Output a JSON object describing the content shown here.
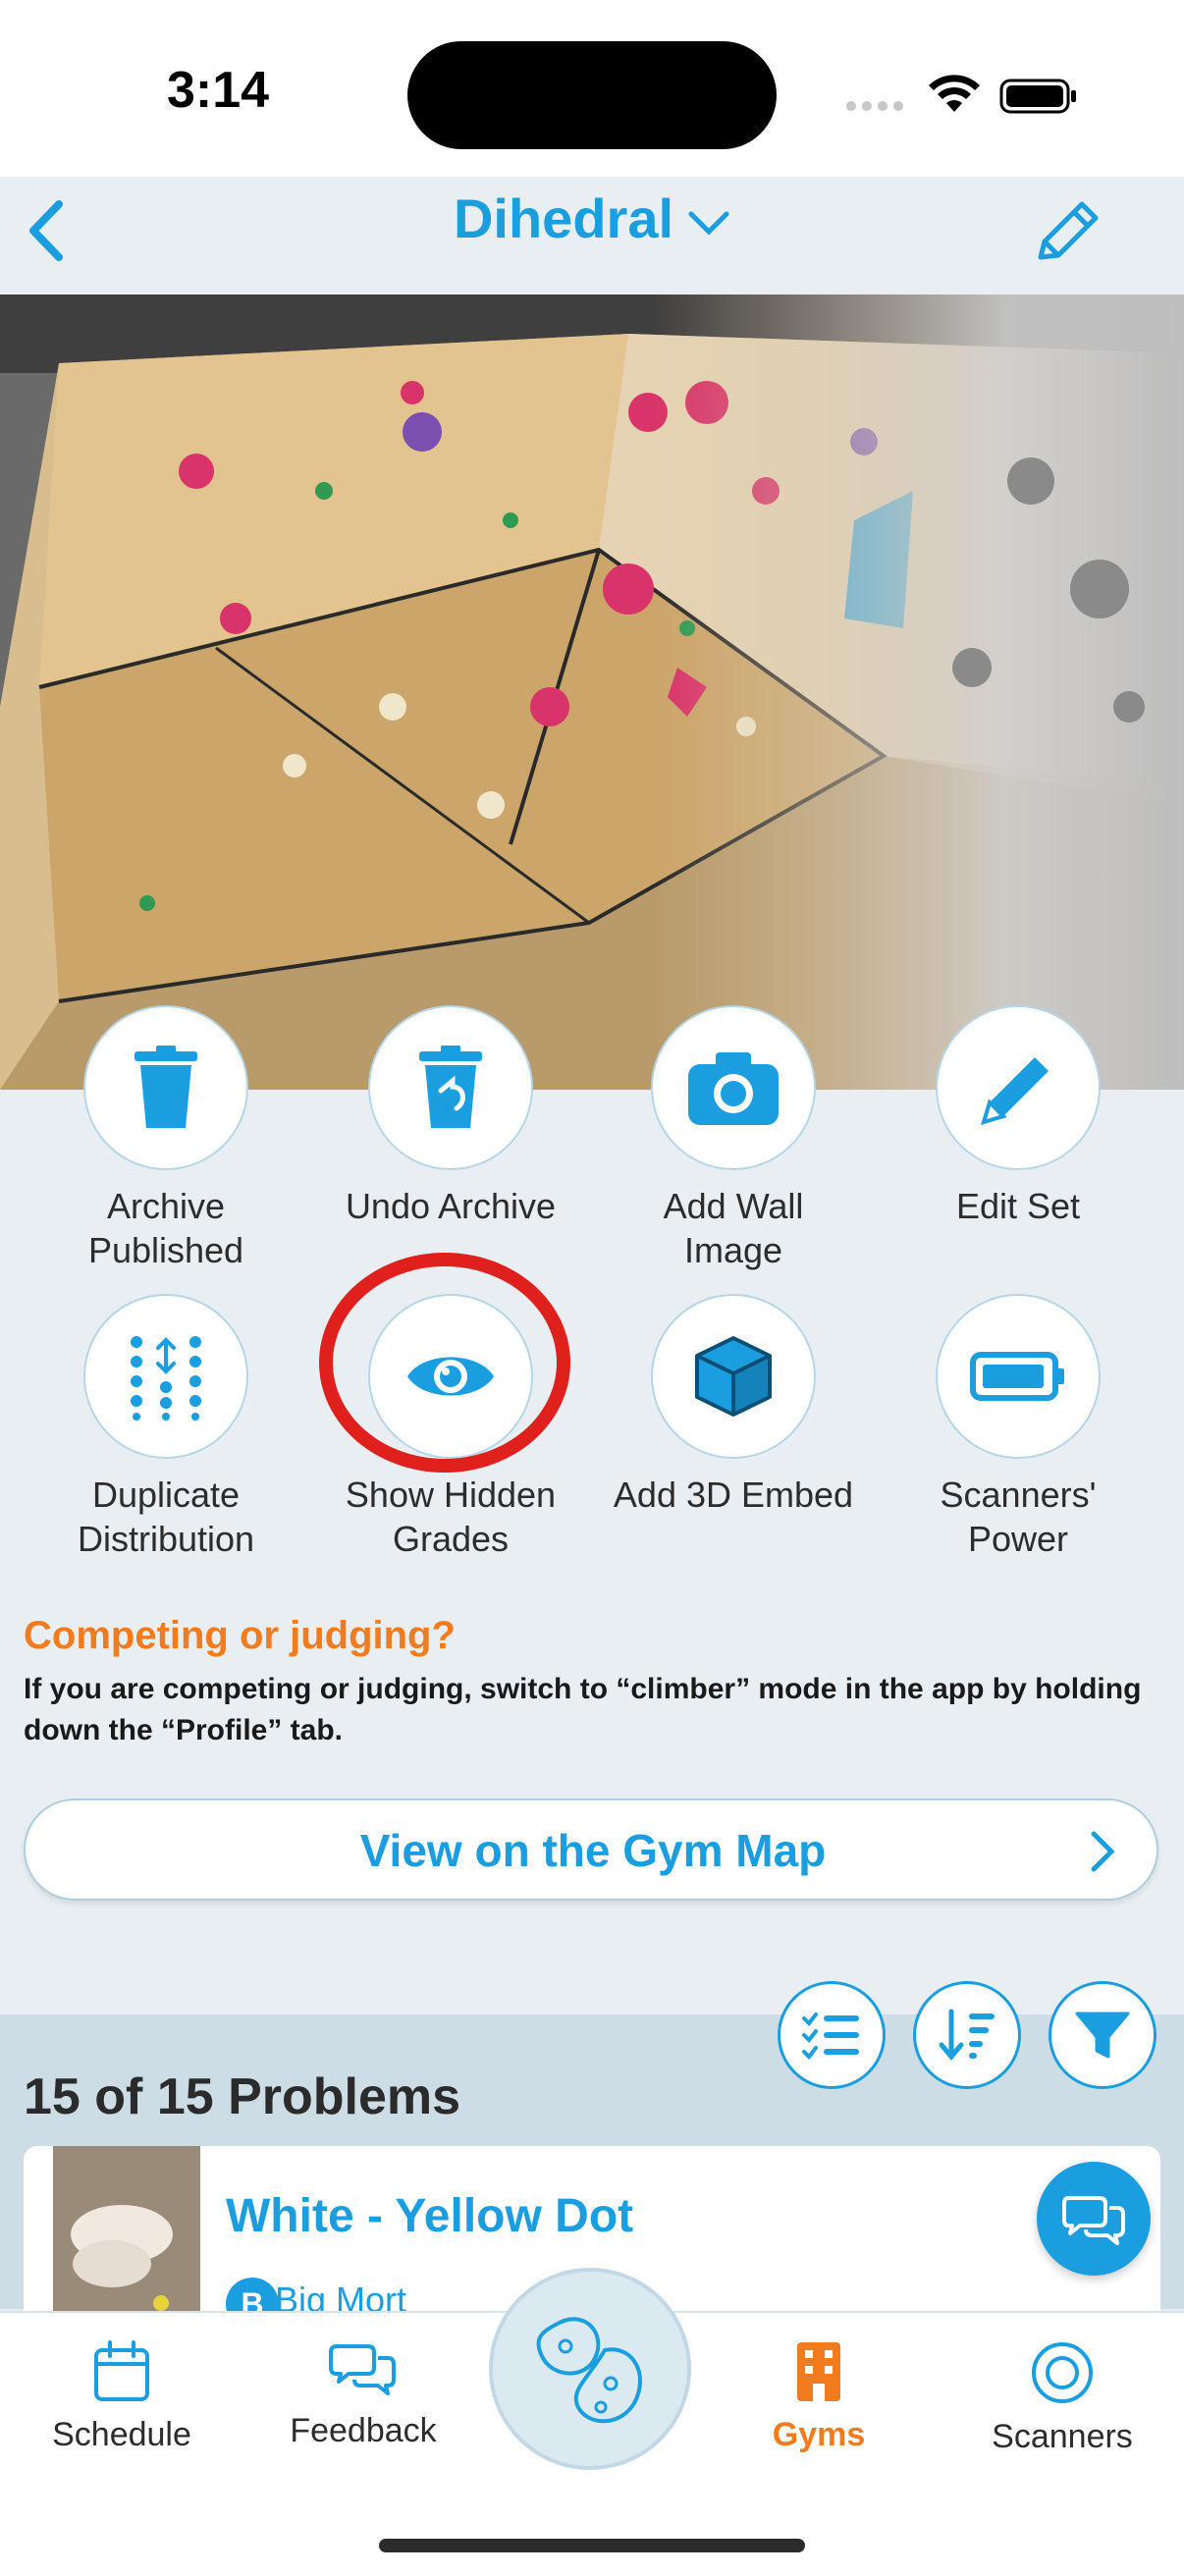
{
  "status": {
    "time": "3:14"
  },
  "nav": {
    "title": "Dihedral"
  },
  "actions": [
    {
      "label_line1": "Archive",
      "label_line2": "Published",
      "icon": "trash-icon"
    },
    {
      "label_line1": "Undo Archive",
      "label_line2": "",
      "icon": "undo-trash-icon"
    },
    {
      "label_line1": "Add Wall",
      "label_line2": "Image",
      "icon": "camera-icon"
    },
    {
      "label_line1": "Edit Set",
      "label_line2": "",
      "icon": "pencil-icon"
    },
    {
      "label_line1": "Duplicate",
      "label_line2": "Distribution",
      "icon": "dots-grid-icon"
    },
    {
      "label_line1": "Show Hidden",
      "label_line2": "Grades",
      "icon": "eye-icon"
    },
    {
      "label_line1": "Add 3D Embed",
      "label_line2": "",
      "icon": "cube-icon"
    },
    {
      "label_line1": "Scanners'",
      "label_line2": "Power",
      "icon": "battery-icon"
    }
  ],
  "compete": {
    "title": "Competing or judging?",
    "text": "If you are competing or judging, switch to “climber” mode in the app by holding down the “Profile” tab."
  },
  "map_button": {
    "label": "View on the Gym Map"
  },
  "problems": {
    "count": "15 of 15 Problems",
    "items": [
      {
        "title": "White - Yellow Dot",
        "setter": "Big Mort",
        "setter_initial": "B"
      }
    ]
  },
  "tabs": [
    {
      "label": "Schedule",
      "icon": "calendar-icon"
    },
    {
      "label": "Feedback",
      "icon": "chat-bubbles-icon"
    },
    {
      "label": "Gyms",
      "icon": "building-icon"
    },
    {
      "label": "Scanners",
      "icon": "scanner-target-icon"
    }
  ],
  "colors": {
    "accent": "#1a9ee0",
    "orange": "#f27b1e",
    "highlight": "#e0201d"
  }
}
